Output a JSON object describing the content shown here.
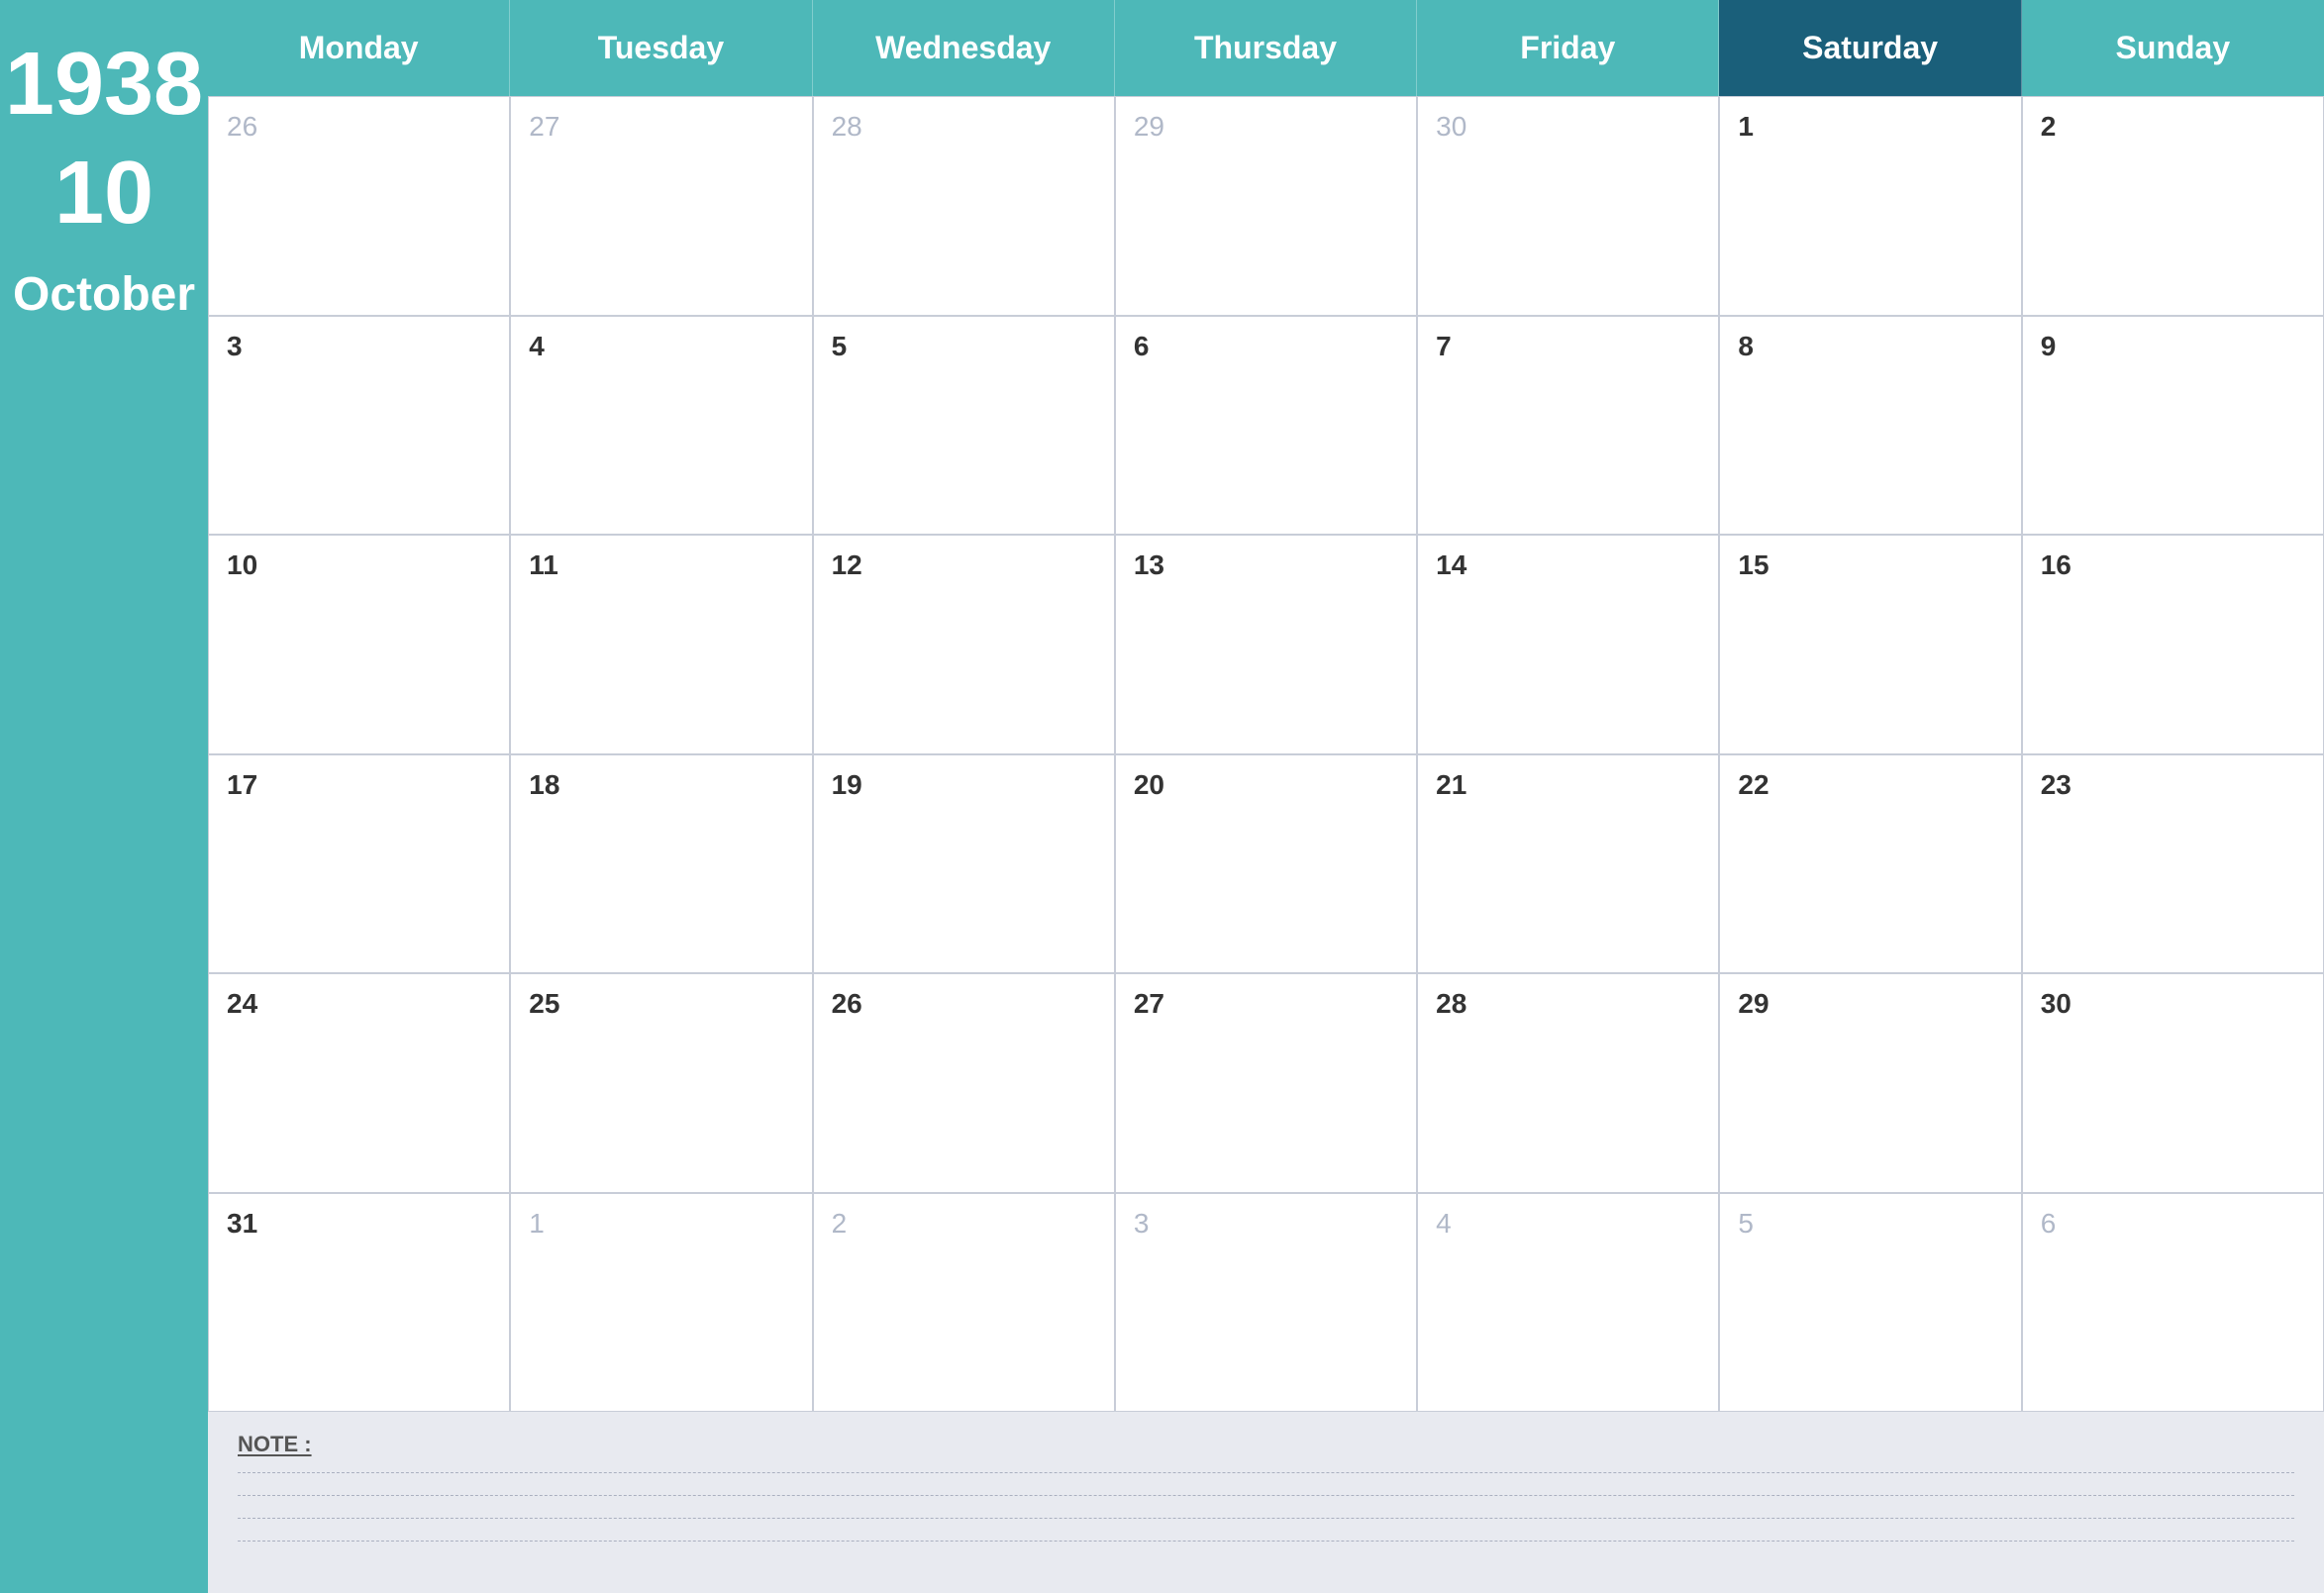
{
  "sidebar": {
    "year": "1938",
    "month_num": "10",
    "month_name": "October"
  },
  "header": {
    "days": [
      {
        "label": "Monday",
        "highlight": false
      },
      {
        "label": "Tuesday",
        "highlight": false
      },
      {
        "label": "Wednesday",
        "highlight": false
      },
      {
        "label": "Thursday",
        "highlight": false
      },
      {
        "label": "Friday",
        "highlight": false
      },
      {
        "label": "Saturday",
        "highlight": true
      },
      {
        "label": "Sunday",
        "highlight": false
      }
    ]
  },
  "weeks": [
    [
      {
        "day": "26",
        "other": true
      },
      {
        "day": "27",
        "other": true
      },
      {
        "day": "28",
        "other": true
      },
      {
        "day": "29",
        "other": true
      },
      {
        "day": "30",
        "other": true
      },
      {
        "day": "1",
        "other": false
      },
      {
        "day": "2",
        "other": false
      }
    ],
    [
      {
        "day": "3",
        "other": false
      },
      {
        "day": "4",
        "other": false
      },
      {
        "day": "5",
        "other": false
      },
      {
        "day": "6",
        "other": false
      },
      {
        "day": "7",
        "other": false
      },
      {
        "day": "8",
        "other": false
      },
      {
        "day": "9",
        "other": false
      }
    ],
    [
      {
        "day": "10",
        "other": false
      },
      {
        "day": "11",
        "other": false
      },
      {
        "day": "12",
        "other": false
      },
      {
        "day": "13",
        "other": false
      },
      {
        "day": "14",
        "other": false
      },
      {
        "day": "15",
        "other": false
      },
      {
        "day": "16",
        "other": false
      }
    ],
    [
      {
        "day": "17",
        "other": false
      },
      {
        "day": "18",
        "other": false
      },
      {
        "day": "19",
        "other": false
      },
      {
        "day": "20",
        "other": false
      },
      {
        "day": "21",
        "other": false
      },
      {
        "day": "22",
        "other": false
      },
      {
        "day": "23",
        "other": false
      }
    ],
    [
      {
        "day": "24",
        "other": false
      },
      {
        "day": "25",
        "other": false
      },
      {
        "day": "26",
        "other": false
      },
      {
        "day": "27",
        "other": false
      },
      {
        "day": "28",
        "other": false
      },
      {
        "day": "29",
        "other": false
      },
      {
        "day": "30",
        "other": false
      }
    ],
    [
      {
        "day": "31",
        "other": false
      },
      {
        "day": "1",
        "other": true
      },
      {
        "day": "2",
        "other": true
      },
      {
        "day": "3",
        "other": true
      },
      {
        "day": "4",
        "other": true
      },
      {
        "day": "5",
        "other": true
      },
      {
        "day": "6",
        "other": true
      }
    ]
  ],
  "notes": {
    "label": "NOTE :",
    "lines": 4
  }
}
